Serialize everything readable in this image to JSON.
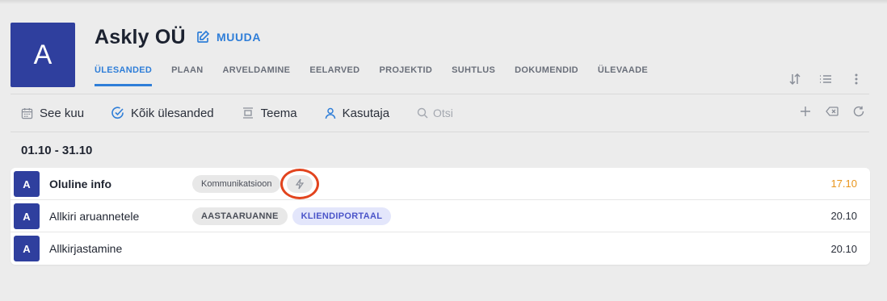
{
  "header": {
    "avatar_letter": "A",
    "company_name": "Askly OÜ",
    "edit_label": "MUUDA"
  },
  "tabs": [
    {
      "label": "ÜLESANDED",
      "active": true
    },
    {
      "label": "PLAAN"
    },
    {
      "label": "ARVELDAMINE"
    },
    {
      "label": "EELARVED"
    },
    {
      "label": "PROJEKTID"
    },
    {
      "label": "SUHTLUS"
    },
    {
      "label": "DOKUMENDID"
    },
    {
      "label": "ÜLEVAADE"
    }
  ],
  "toolbar": {
    "month_label": "See kuu",
    "tasks_label": "Kõik ülesanded",
    "topic_label": "Teema",
    "user_label": "Kasutaja",
    "search_placeholder": "Otsi"
  },
  "date_range": "01.10 - 31.10",
  "tasks": [
    {
      "avatar": "A",
      "title": "Oluline info",
      "tags": [
        "Kommunikatsioon"
      ],
      "date": "17.10",
      "date_color": "#e8951c"
    },
    {
      "avatar": "A",
      "title": "Allkiri aruannetele",
      "tags": [
        "AASTAARUANNE",
        "KLIENDIPORTAAL"
      ],
      "date": "20.10"
    },
    {
      "avatar": "A",
      "title": "Allkirjastamine",
      "tags": [],
      "date": "20.10"
    }
  ],
  "colors": {
    "accent": "#2f7ed8",
    "avatar_bg": "#2f3f9e",
    "highlight_ring": "#e2441e",
    "due_soon": "#e8951c"
  }
}
